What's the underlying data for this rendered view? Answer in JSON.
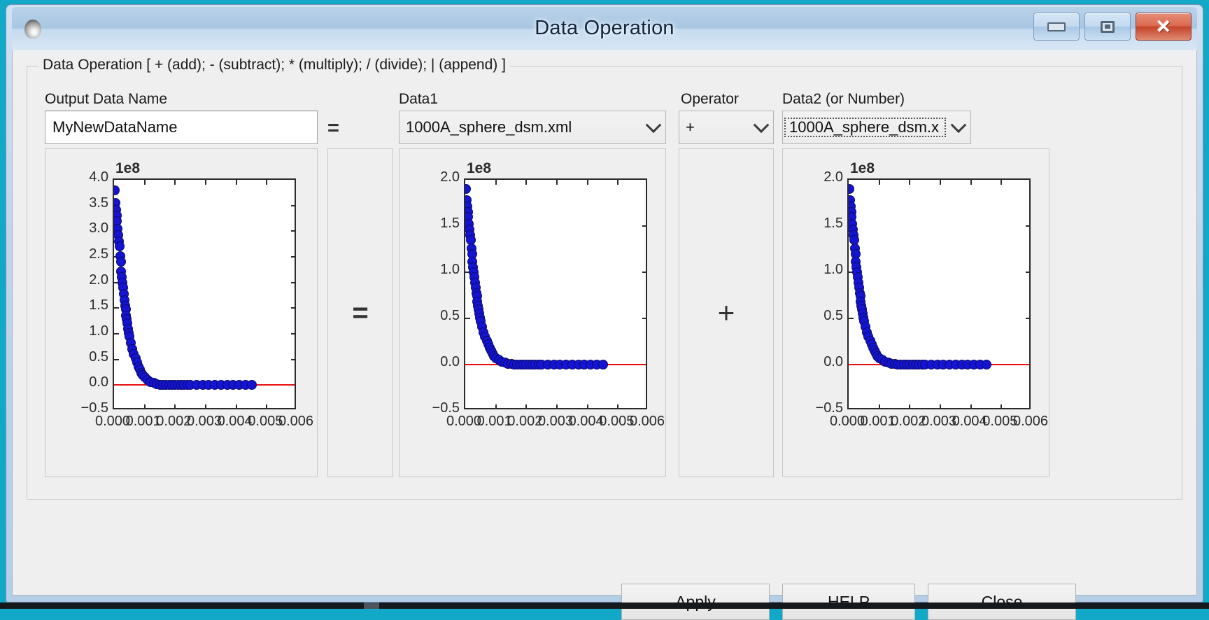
{
  "window": {
    "title": "Data Operation",
    "icon": "app-sphere-icon",
    "buttons": {
      "minimize": "minimize",
      "maximize": "maximize",
      "close": "✕"
    }
  },
  "groupbox": {
    "title": "Data Operation [ + (add); - (subtract); * (multiply); / (divide); | (append) ]"
  },
  "fields": {
    "output_label": "Output Data Name",
    "output_value": "MyNewDataName",
    "data1_label": "Data1",
    "data1_value": "1000A_sphere_dsm.xml",
    "operator_label": "Operator",
    "operator_value": "+",
    "data2_label": "Data2 (or Number)",
    "data2_value": "1000A_sphere_dsm.x"
  },
  "separators": {
    "equals_small": "=",
    "equals_big": "=",
    "plus_big": "+"
  },
  "footer": {
    "apply": "Apply",
    "help": "HELP",
    "close": "Close"
  },
  "colors": {
    "marker": "#1414d2",
    "zero_line": "#e81010",
    "window_frame": "#b4cee6",
    "client_bg": "#efefef"
  },
  "chart_data": [
    {
      "id": "result-plot",
      "type": "scatter",
      "title": "",
      "offset_text": "1e8",
      "xlabel": "",
      "ylabel": "",
      "yticks": [
        "4.0",
        "3.5",
        "3.0",
        "2.5",
        "2.0",
        "1.5",
        "1.0",
        "0.5",
        "0.0",
        "-0.5"
      ],
      "ytick_values": [
        4.0,
        3.5,
        3.0,
        2.5,
        2.0,
        1.5,
        1.0,
        0.5,
        0.0,
        -0.5
      ],
      "ylim": [
        -0.5,
        4.0
      ],
      "xticks": [
        "0.000",
        "0.001",
        "0.002",
        "0.003",
        "0.004",
        "0.005",
        "0.006"
      ],
      "xtick_values": [
        0.0,
        0.001,
        0.002,
        0.003,
        0.004,
        0.005,
        0.006
      ],
      "xlim": [
        0.0,
        0.006
      ],
      "grid": false,
      "legend": "none",
      "annotations": [
        "red horizontal reference line at y = 0"
      ],
      "x": [
        2e-05,
        4e-05,
        6e-05,
        8e-05,
        0.0001,
        0.00012,
        0.00014,
        0.00016,
        0.00018,
        0.0002,
        0.00022,
        0.00024,
        0.00026,
        0.00028,
        0.0003,
        0.00032,
        0.00034,
        0.00036,
        0.00038,
        0.0004,
        0.00042,
        0.00044,
        0.00046,
        0.00048,
        0.0005,
        0.00055,
        0.0006,
        0.00065,
        0.0007,
        0.00075,
        0.0008,
        0.00085,
        0.0009,
        0.00095,
        0.001,
        0.0011,
        0.0012,
        0.0013,
        0.0014,
        0.0015,
        0.0016,
        0.0017,
        0.0018,
        0.0019,
        0.002,
        0.0021,
        0.0022,
        0.0023,
        0.0024,
        0.0025,
        0.0027,
        0.0029,
        0.0031,
        0.0033,
        0.0035,
        0.0037,
        0.0039,
        0.0041,
        0.0043,
        0.0045
      ],
      "y": [
        3.8,
        3.55,
        3.42,
        3.3,
        3.2,
        3.05,
        2.92,
        2.8,
        2.7,
        2.52,
        2.4,
        2.22,
        2.1,
        2.0,
        1.9,
        1.78,
        1.66,
        1.54,
        1.48,
        1.36,
        1.28,
        1.2,
        1.1,
        1.02,
        0.95,
        0.82,
        0.7,
        0.6,
        0.52,
        0.44,
        0.36,
        0.3,
        0.24,
        0.19,
        0.15,
        0.1,
        0.06,
        0.04,
        0.02,
        0.01,
        0.01,
        0.0,
        0.0,
        0.0,
        0.0,
        0.0,
        0.0,
        0.0,
        0.0,
        0.0,
        0.0,
        0.0,
        0.0,
        0.0,
        0.0,
        0.0,
        0.0,
        0.0,
        0.0,
        0.0
      ]
    },
    {
      "id": "data1-plot",
      "type": "scatter",
      "title": "",
      "offset_text": "1e8",
      "xlabel": "",
      "ylabel": "",
      "yticks": [
        "2.0",
        "1.5",
        "1.0",
        "0.5",
        "0.0",
        "-0.5"
      ],
      "ytick_values": [
        2.0,
        1.5,
        1.0,
        0.5,
        0.0,
        -0.5
      ],
      "ylim": [
        -0.5,
        2.0
      ],
      "xticks": [
        "0.000",
        "0.001",
        "0.002",
        "0.003",
        "0.004",
        "0.005",
        "0.006"
      ],
      "xtick_values": [
        0.0,
        0.001,
        0.002,
        0.003,
        0.004,
        0.005,
        0.006
      ],
      "xlim": [
        0.0,
        0.006
      ],
      "grid": false,
      "legend": "none",
      "annotations": [
        "red horizontal reference line at y = 0"
      ],
      "x": [
        2e-05,
        4e-05,
        6e-05,
        8e-05,
        0.0001,
        0.00012,
        0.00014,
        0.00016,
        0.00018,
        0.0002,
        0.00022,
        0.00024,
        0.00026,
        0.00028,
        0.0003,
        0.00032,
        0.00034,
        0.00036,
        0.00038,
        0.0004,
        0.00042,
        0.00044,
        0.00046,
        0.00048,
        0.0005,
        0.00055,
        0.0006,
        0.00065,
        0.0007,
        0.00075,
        0.0008,
        0.00085,
        0.0009,
        0.00095,
        0.001,
        0.0011,
        0.0012,
        0.0013,
        0.0014,
        0.0015,
        0.0016,
        0.0017,
        0.0018,
        0.0019,
        0.002,
        0.0021,
        0.0022,
        0.0023,
        0.0024,
        0.0025,
        0.0027,
        0.0029,
        0.0031,
        0.0033,
        0.0035,
        0.0037,
        0.0039,
        0.0041,
        0.0043,
        0.0045
      ],
      "y": [
        1.9,
        1.78,
        1.71,
        1.65,
        1.6,
        1.52,
        1.46,
        1.4,
        1.35,
        1.26,
        1.2,
        1.11,
        1.05,
        1.0,
        0.95,
        0.89,
        0.83,
        0.77,
        0.74,
        0.68,
        0.64,
        0.6,
        0.55,
        0.51,
        0.47,
        0.41,
        0.35,
        0.3,
        0.26,
        0.22,
        0.18,
        0.15,
        0.12,
        0.09,
        0.07,
        0.05,
        0.03,
        0.02,
        0.01,
        0.01,
        0.0,
        0.0,
        0.0,
        0.0,
        0.0,
        0.0,
        0.0,
        0.0,
        0.0,
        0.0,
        0.0,
        0.0,
        0.0,
        0.0,
        0.0,
        0.0,
        0.0,
        0.0,
        0.0,
        0.0
      ]
    },
    {
      "id": "data2-plot",
      "type": "scatter",
      "title": "",
      "offset_text": "1e8",
      "xlabel": "",
      "ylabel": "",
      "yticks": [
        "2.0",
        "1.5",
        "1.0",
        "0.5",
        "0.0",
        "-0.5"
      ],
      "ytick_values": [
        2.0,
        1.5,
        1.0,
        0.5,
        0.0,
        -0.5
      ],
      "ylim": [
        -0.5,
        2.0
      ],
      "xticks": [
        "0.000",
        "0.001",
        "0.002",
        "0.003",
        "0.004",
        "0.005",
        "0.006"
      ],
      "xtick_values": [
        0.0,
        0.001,
        0.002,
        0.003,
        0.004,
        0.005,
        0.006
      ],
      "xlim": [
        0.0,
        0.006
      ],
      "grid": false,
      "legend": "none",
      "annotations": [
        "red horizontal reference line at y = 0"
      ],
      "x": [
        2e-05,
        4e-05,
        6e-05,
        8e-05,
        0.0001,
        0.00012,
        0.00014,
        0.00016,
        0.00018,
        0.0002,
        0.00022,
        0.00024,
        0.00026,
        0.00028,
        0.0003,
        0.00032,
        0.00034,
        0.00036,
        0.00038,
        0.0004,
        0.00042,
        0.00044,
        0.00046,
        0.00048,
        0.0005,
        0.00055,
        0.0006,
        0.00065,
        0.0007,
        0.00075,
        0.0008,
        0.00085,
        0.0009,
        0.00095,
        0.001,
        0.0011,
        0.0012,
        0.0013,
        0.0014,
        0.0015,
        0.0016,
        0.0017,
        0.0018,
        0.0019,
        0.002,
        0.0021,
        0.0022,
        0.0023,
        0.0024,
        0.0025,
        0.0027,
        0.0029,
        0.0031,
        0.0033,
        0.0035,
        0.0037,
        0.0039,
        0.0041,
        0.0043,
        0.0045
      ],
      "y": [
        1.9,
        1.78,
        1.71,
        1.65,
        1.6,
        1.52,
        1.46,
        1.4,
        1.35,
        1.26,
        1.2,
        1.11,
        1.05,
        1.0,
        0.95,
        0.89,
        0.83,
        0.77,
        0.74,
        0.68,
        0.64,
        0.6,
        0.55,
        0.51,
        0.47,
        0.41,
        0.35,
        0.3,
        0.26,
        0.22,
        0.18,
        0.15,
        0.12,
        0.09,
        0.07,
        0.05,
        0.03,
        0.02,
        0.01,
        0.01,
        0.0,
        0.0,
        0.0,
        0.0,
        0.0,
        0.0,
        0.0,
        0.0,
        0.0,
        0.0,
        0.0,
        0.0,
        0.0,
        0.0,
        0.0,
        0.0,
        0.0,
        0.0,
        0.0,
        0.0
      ]
    }
  ]
}
